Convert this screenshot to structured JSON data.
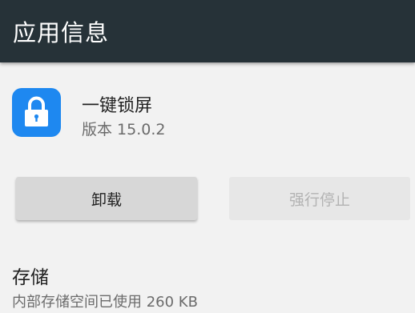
{
  "appbar": {
    "title": "应用信息",
    "background": "#263238"
  },
  "app": {
    "name": "一键锁屏",
    "version": "版本 15.0.2",
    "icon": "lock-icon",
    "icon_color": "#1e88f0"
  },
  "actions": {
    "uninstall_label": "卸载",
    "force_stop_label": "强行停止",
    "force_stop_enabled": false
  },
  "storage": {
    "title": "存储",
    "summary": "内部存储空间已使用 260 KB"
  }
}
